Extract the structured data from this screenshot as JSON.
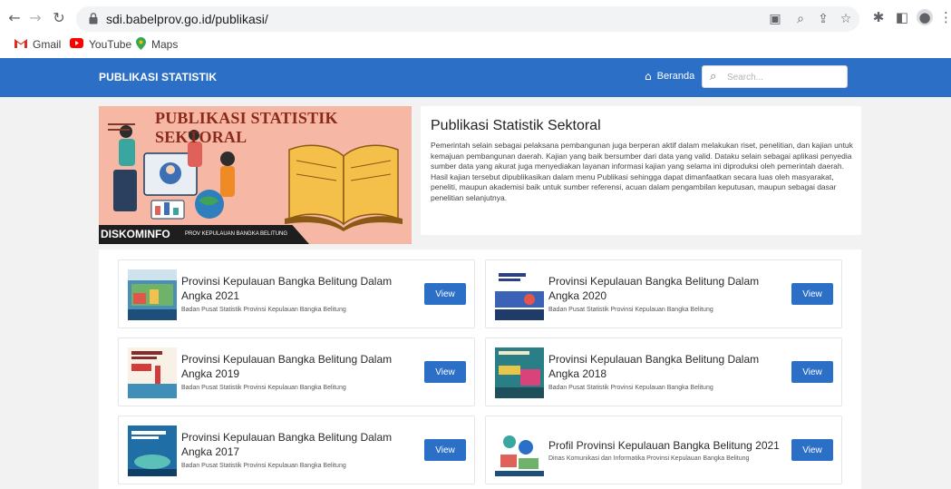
{
  "browser": {
    "url": "sdi.babelprov.go.id/publikasi/",
    "bookmarks": [
      {
        "label": "Gmail",
        "icon": "gmail-icon",
        "color": "#d93025"
      },
      {
        "label": "YouTube",
        "icon": "youtube-icon",
        "color": "#ff0000"
      },
      {
        "label": "Maps",
        "icon": "maps-icon",
        "color": "#34a853"
      }
    ]
  },
  "site": {
    "brand": "PUBLIKASI STATISTIK",
    "nav_home": "Beranda",
    "search_placeholder": "Search...",
    "accent": "#2b6fc6"
  },
  "banner": {
    "title": "PUBLIKASI STATISTIK SEKTORAL",
    "footer_main": "DISKOMINFO",
    "footer_sub": "PROV KEPULAUAN BANGKA BELITUNG"
  },
  "intro": {
    "title": "Publikasi Statistik Sektoral",
    "text": "Pemerintah selain sebagai pelaksana pembangunan juga berperan aktif dalam melakukan riset, penelitian, dan kajian untuk kemajuan pembangunan daerah. Kajian yang baik bersumber dari data yang valid. Dataku selain sebagai aplikasi penyedia sumber data yang akurat juga menyediakan layanan informasi kajian yang selama ini diproduksi oleh pemerintah daerah. Hasil kajian tersebut dipublikasikan dalam menu Publikasi sehingga dapat dimanfaatkan secara luas oleh masyarakat, peneliti, maupun akademisi baik untuk sumber referensi, acuan dalam pengambilan keputusan, maupun sebagai dasar penelitian selanjutnya."
  },
  "publications": [
    {
      "title": "Provinsi Kepulauan Bangka Belitung Dalam Angka 2021",
      "source": "Badan Pusat Statistik Provinsi Kepulauan Bangka Belitung",
      "button": "View"
    },
    {
      "title": "Provinsi Kepulauan Bangka Belitung Dalam Angka 2020",
      "source": "Badan Pusat Statistik Provinsi Kepulauan Bangka Belitung",
      "button": "View"
    },
    {
      "title": "Provinsi Kepulauan Bangka Belitung Dalam Angka 2019",
      "source": "Badan Pusat Statistik Provinsi Kepulauan Bangka Belitung",
      "button": "View"
    },
    {
      "title": "Provinsi Kepulauan Bangka Belitung Dalam Angka 2018",
      "source": "Badan Pusat Statistik Provinsi Kepulauan Bangka Belitung",
      "button": "View"
    },
    {
      "title": "Provinsi Kepulauan Bangka Belitung Dalam Angka 2017",
      "source": "Badan Pusat Statistik Provinsi Kepulauan Bangka Belitung",
      "button": "View"
    },
    {
      "title": "Profil Provinsi Kepulauan Bangka Belitung 2021",
      "source": "Dinas Komunikasi dan Informatika Provinsi Kepulauan Bangka Belitung",
      "button": "View"
    }
  ]
}
